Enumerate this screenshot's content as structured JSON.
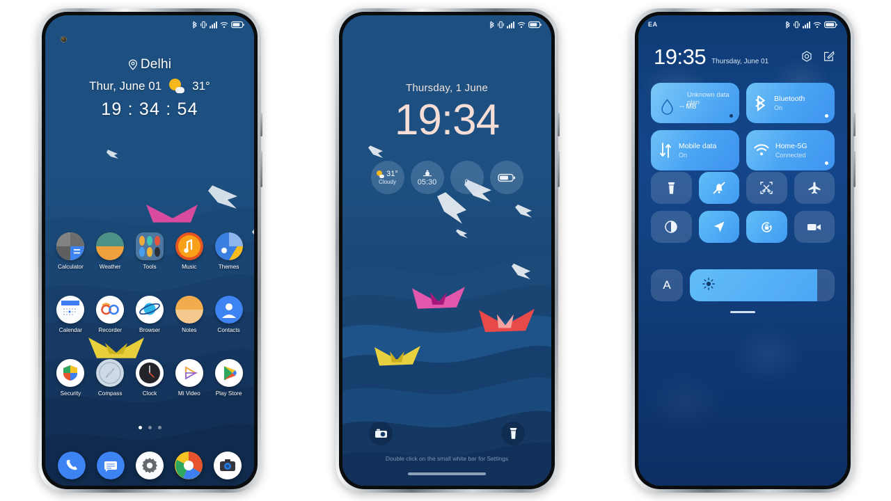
{
  "phones": [
    {
      "name": "home-screen",
      "status_bar": {
        "carrier": "",
        "icons": [
          "bluetooth-icon",
          "vibrate-icon",
          "signal-icon",
          "wifi-icon",
          "battery-icon"
        ]
      },
      "weather_widget": {
        "city": "Delhi",
        "date": "Thur, June 01",
        "temperature": "31°",
        "condition_icon": "sun-cloud-icon",
        "clock": "19 : 34 : 54"
      },
      "apps": [
        {
          "label": "Calculator",
          "icon": "calculator-icon"
        },
        {
          "label": "Weather",
          "icon": "weather-icon"
        },
        {
          "label": "Tools",
          "icon": "tools-folder-icon"
        },
        {
          "label": "Music",
          "icon": "music-icon"
        },
        {
          "label": "Themes",
          "icon": "themes-icon"
        },
        {
          "label": "Calendar",
          "icon": "calendar-icon"
        },
        {
          "label": "Recorder",
          "icon": "recorder-icon"
        },
        {
          "label": "Browser",
          "icon": "browser-icon"
        },
        {
          "label": "Notes",
          "icon": "notes-icon"
        },
        {
          "label": "Contacts",
          "icon": "contacts-icon"
        },
        {
          "label": "Security",
          "icon": "security-icon"
        },
        {
          "label": "Compass",
          "icon": "compass-icon"
        },
        {
          "label": "Clock",
          "icon": "clock-icon"
        },
        {
          "label": "Mi Video",
          "icon": "mi-video-icon"
        },
        {
          "label": "Play Store",
          "icon": "play-store-icon"
        }
      ],
      "page_indicator": {
        "pages": 3,
        "active": 1
      },
      "dock": [
        {
          "label": "Phone",
          "icon": "phone-icon"
        },
        {
          "label": "Messages",
          "icon": "messages-icon"
        },
        {
          "label": "Settings",
          "icon": "settings-gear-icon"
        },
        {
          "label": "Gallery",
          "icon": "gallery-icon"
        },
        {
          "label": "Camera",
          "icon": "camera-icon"
        }
      ]
    },
    {
      "name": "lock-screen",
      "status_bar": {
        "carrier": "",
        "icons": [
          "bluetooth-icon",
          "vibrate-icon",
          "signal-icon",
          "wifi-icon",
          "battery-icon"
        ]
      },
      "date": "Thursday, 1 June",
      "time": "19:34",
      "pills": [
        {
          "icon": "sun-cloud-icon",
          "value": "31°",
          "sub": "Cloudy"
        },
        {
          "icon": "sunset-icon",
          "value": "",
          "sub": "05:30"
        },
        {
          "icon": "moon-icon",
          "value": "",
          "sub": "0"
        },
        {
          "icon": "battery-icon",
          "value": "",
          "sub": ""
        }
      ],
      "shortcuts": [
        {
          "icon": "camera-icon",
          "label": "Camera"
        },
        {
          "icon": "flashlight-icon",
          "label": "Flashlight"
        }
      ],
      "hint": "Double click on the small white bar for Settings"
    },
    {
      "name": "control-center",
      "status_bar": {
        "carrier": "EA",
        "icons": [
          "bluetooth-icon",
          "vibrate-icon",
          "signal-icon",
          "wifi-icon",
          "battery-icon"
        ]
      },
      "time": "19:35",
      "date": "Thursday, June 01",
      "header_actions": [
        {
          "icon": "settings-gear-icon",
          "label": "Settings"
        },
        {
          "icon": "edit-icon",
          "label": "Edit"
        }
      ],
      "big_tiles": [
        {
          "icon": "data-usage-icon",
          "title": "Unknown data plan",
          "subtitle": "-- MB",
          "state": "off"
        },
        {
          "icon": "bluetooth-icon",
          "title": "Bluetooth",
          "subtitle": "On",
          "state": "on"
        },
        {
          "icon": "mobile-data-icon",
          "title": "Mobile data",
          "subtitle": "On",
          "state": "on"
        },
        {
          "icon": "wifi-icon",
          "title": "Home-5G",
          "subtitle": "Connected",
          "state": "on"
        }
      ],
      "quick_tiles": [
        {
          "icon": "flashlight-icon",
          "label": "Flashlight",
          "state": "off"
        },
        {
          "icon": "silent-bell-icon",
          "label": "Silent",
          "state": "on"
        },
        {
          "icon": "screenshot-icon",
          "label": "Screenshot",
          "state": "off"
        },
        {
          "icon": "airplane-icon",
          "label": "Airplane mode",
          "state": "off"
        },
        {
          "icon": "dark-mode-icon",
          "label": "Dark mode",
          "state": "off"
        },
        {
          "icon": "location-icon",
          "label": "Location",
          "state": "on"
        },
        {
          "icon": "rotation-lock-icon",
          "label": "Rotation lock",
          "state": "on"
        },
        {
          "icon": "screen-recorder-icon",
          "label": "Screen recorder",
          "state": "off"
        }
      ],
      "auto_brightness": {
        "label": "A",
        "icon": "auto-brightness-icon"
      },
      "brightness": {
        "icon": "brightness-sun-icon",
        "percent": 88
      }
    }
  ]
}
